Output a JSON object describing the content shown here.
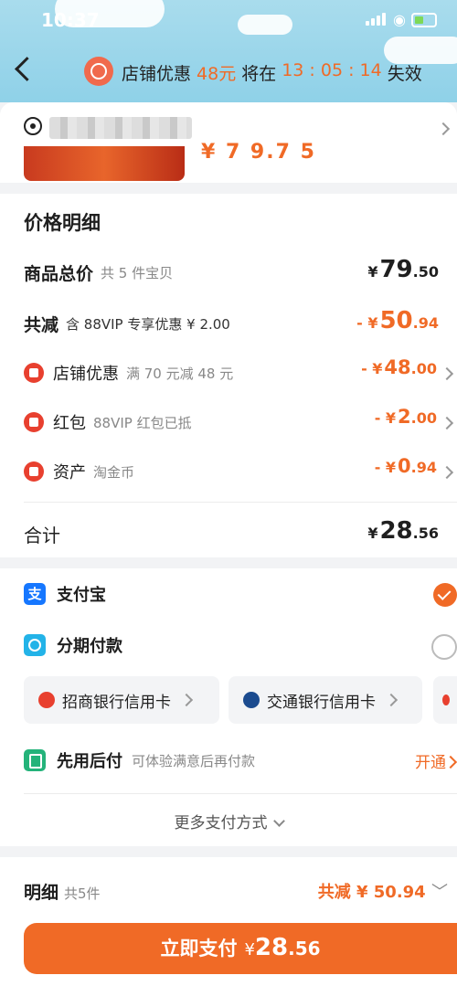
{
  "status": {
    "time": "10:37"
  },
  "nav": {
    "prefix": "店铺优惠",
    "amount": "48元",
    "mid": "将在",
    "countdown": "13 : 05 : 14",
    "suffix": "失效"
  },
  "product": {
    "price_partial": "¥ 7 9.7 5"
  },
  "price_detail": {
    "title": "价格明细",
    "total": {
      "label": "商品总价",
      "sub": "共 5 件宝贝",
      "yen": "¥",
      "int": "79",
      "dec": ".50"
    },
    "reduce": {
      "label": "共减",
      "sub": "含 88VIP 专享优惠 ¥ 2.00",
      "prefix": "- ¥",
      "int": "50",
      "dec": ".94"
    },
    "items": [
      {
        "label": "店铺优惠",
        "sub": "满 70 元减 48 元",
        "prefix": "- ¥",
        "int": "48",
        "dec": ".00"
      },
      {
        "label": "红包",
        "sub": "88VIP 红包已抵",
        "prefix": "- ¥",
        "int": "2",
        "dec": ".00"
      },
      {
        "label": "资产",
        "sub": "淘金币",
        "prefix": "- ¥",
        "int": "0",
        "dec": ".94"
      }
    ],
    "sum": {
      "label": "合计",
      "yen": "¥",
      "int": "28",
      "dec": ".56"
    }
  },
  "payment": {
    "alipay": "支付宝",
    "installment": "分期付款",
    "banks": [
      "招商银行信用卡",
      "交通银行信用卡"
    ],
    "paylater": {
      "label": "先用后付",
      "sub": "可体验满意后再付款",
      "action": "开通"
    },
    "more": "更多支付方式"
  },
  "bottom": {
    "detail": "明细",
    "count": "共5件",
    "reduce": "共减 ¥ 50.94",
    "pay_label": "立即支付",
    "yen": "¥",
    "int": "28",
    "dec": ".56"
  },
  "colors": {
    "accent": "#f06a26",
    "header": "#a9dced",
    "alipay": "#1677ff"
  }
}
